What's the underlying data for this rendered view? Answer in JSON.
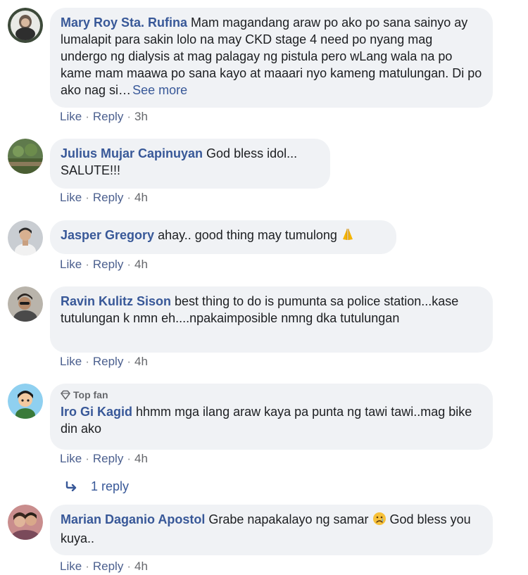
{
  "comments": [
    {
      "author": "Mary Roy Sta. Rufina",
      "text": "Mam magandang araw po ako po sana sainyo ay lumalapit para sakin lolo na may CKD stage 4 need po nyang mag undergo ng dialysis at mag palagay ng pistula pero wLang wala na po kame mam maawa po sana kayo at maaari nyo kameng matulungan. Di po ako nag si…",
      "see_more": "See more",
      "like": "Like",
      "reply": "Reply",
      "time": "3h"
    },
    {
      "author": "Julius Mujar Capinuyan",
      "text": "God bless idol... SALUTE!!!",
      "like": "Like",
      "reply": "Reply",
      "time": "4h"
    },
    {
      "author": "Jasper Gregory",
      "text": "ahay.. good thing may tumulong",
      "emoji": "folded-hands-emoji",
      "like": "Like",
      "reply": "Reply",
      "time": "4h"
    },
    {
      "author": "Ravin Kulitz Sison",
      "text": "best thing to do is pumunta sa police station...kase tutulungan k nmn eh....npakaimposible nmng dka tutulungan",
      "like": "Like",
      "reply": "Reply",
      "time": "4h"
    },
    {
      "badge": "Top fan",
      "author": "Iro Gi Kagid",
      "text": "hhmm mga ilang araw kaya pa punta ng tawi tawi..mag bike din ako",
      "like": "Like",
      "reply": "Reply",
      "time": "4h",
      "replies_label": "1 reply"
    },
    {
      "author": "Marian Daganio Apostol",
      "text": "Grabe napakalayo ng samar",
      "emoji": "sad-face-emoji",
      "text_after": "God bless you kuya..",
      "like": "Like",
      "reply": "Reply",
      "time": "4h"
    }
  ],
  "colors": {
    "author": "#385898",
    "bubble": "#f0f2f5",
    "meta": "#65676b"
  }
}
